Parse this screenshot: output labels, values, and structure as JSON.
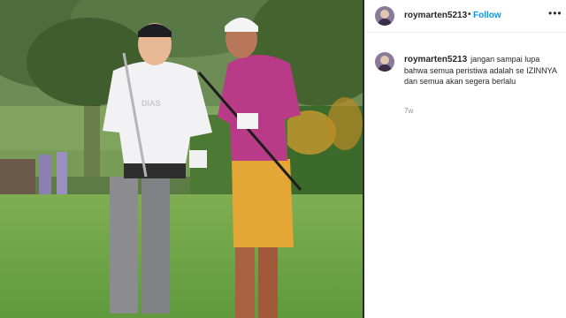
{
  "post": {
    "username": "roymarten5213",
    "follow_label": "Follow",
    "separator": "•",
    "more_icon": "more-options-icon",
    "caption": "jangan sampai lupa bahwa semua peristiwa adalah se IZINNYA dan semua akan segera berlalu",
    "age": "7w"
  },
  "photo": {
    "shirt_logo": "DIAS"
  },
  "colors": {
    "follow_blue": "#0095f6",
    "text": "#262626",
    "muted": "#8e8e8e"
  }
}
